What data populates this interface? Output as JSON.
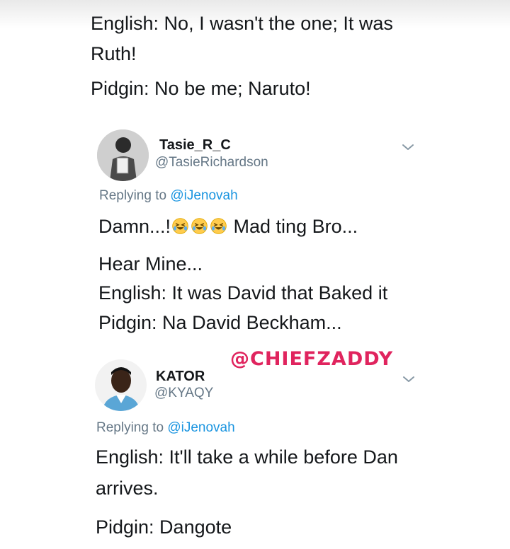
{
  "tweet_top": {
    "lines": [
      "English: No, I wasn't the one; It was",
      "Ruth!",
      "Pidgin: No be me; Naruto!"
    ]
  },
  "tweet1": {
    "display_name": "Tasie_R_C",
    "handle": "@TasieRichardson",
    "replying_prefix": "Replying to ",
    "replying_mention": "@iJenovah",
    "line1_prefix": "Damn...!",
    "line1_suffix": " Mad ting Bro...",
    "emojis": [
      "rolling-on-floor-laughing",
      "rolling-on-floor-laughing",
      "rolling-on-floor-laughing"
    ],
    "lines": [
      "Hear Mine...",
      "English: It was David that Baked it",
      "Pidgin: Na David Beckham..."
    ]
  },
  "watermark": "@CHIEFZADDY",
  "tweet2": {
    "display_name": "KATOR",
    "handle": "@KYAQY",
    "replying_prefix": "Replying to ",
    "replying_mention": "@iJenovah",
    "lines": [
      "English: It'll take a while before Dan",
      "arrives.",
      "Pidgin: Dangote"
    ]
  },
  "colors": {
    "text": "#14171a",
    "secondary": "#657786",
    "link": "#1b95e0",
    "watermark": "#e0245e"
  },
  "icons": {
    "chevron": "chevron-down-icon",
    "emoji": "rolling-on-floor-laughing-emoji"
  }
}
